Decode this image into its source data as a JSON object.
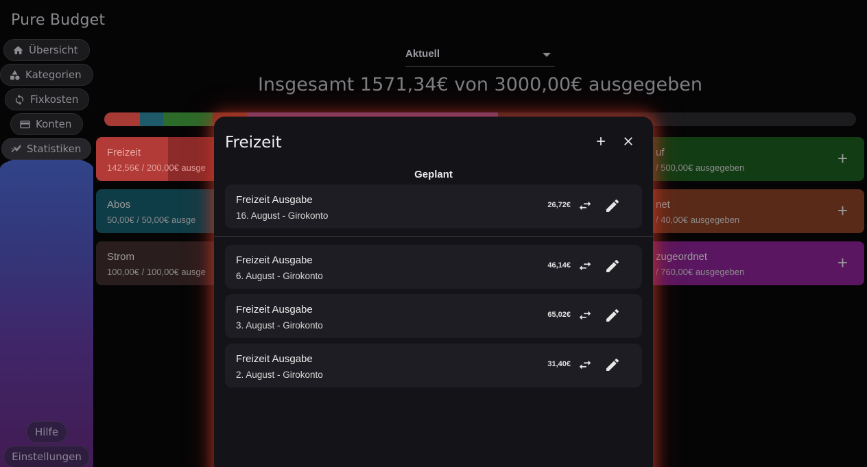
{
  "app": {
    "title": "Pure Budget"
  },
  "sidebar": {
    "items": [
      {
        "label": "Übersicht",
        "icon": "home-icon"
      },
      {
        "label": "Kategorien",
        "icon": "shapes-icon"
      },
      {
        "label": "Fixkosten",
        "icon": "sync-icon"
      },
      {
        "label": "Konten",
        "icon": "wallet-icon"
      },
      {
        "label": "Statistiken",
        "icon": "chart-icon",
        "active": true
      }
    ],
    "bottom": {
      "help": "Hilfe",
      "settings": "Einstellungen"
    }
  },
  "main": {
    "period": {
      "selected": "Aktuell"
    },
    "total_text": "Insgesamt 1571,34€ von 3000,00€ ausgegeben",
    "progress": {
      "spent": 1571.34,
      "budget": 3000.0
    },
    "categories": [
      {
        "name": "Freizeit",
        "value": "142,56€ / 200,00€ ausge",
        "color": "#b23a37"
      },
      {
        "name": "Abos",
        "value": "50,00€ / 50,00€ ausge",
        "color": "#0f3d47"
      },
      {
        "name": "Strom",
        "value": "100,00€ / 100,00€ ausge",
        "color": "#2a1d1d"
      },
      {
        "name": "uf",
        "value": "/ 500,00€ ausgegeben",
        "color": "#123d14"
      },
      {
        "name": "net",
        "value": "/ 40,00€ ausgegeben",
        "color": "#5a2a18"
      },
      {
        "name": "zugeordnet",
        "value": "/ 760,00€ ausgegeben",
        "color": "#5a1660"
      }
    ],
    "plus_label": "+"
  },
  "modal": {
    "title": "Freizeit",
    "section_label": "Geplant",
    "planned": [
      {
        "title": "Freizeit Ausgabe",
        "subtitle": "16. August - Girokonto",
        "amount": "26,72€"
      }
    ],
    "expenses": [
      {
        "title": "Freizeit Ausgabe",
        "subtitle": "6. August - Girokonto",
        "amount": "46,14€"
      },
      {
        "title": "Freizeit Ausgabe",
        "subtitle": "3. August - Girokonto",
        "amount": "65,02€"
      },
      {
        "title": "Freizeit Ausgabe",
        "subtitle": "2. August - Girokonto",
        "amount": "31,40€"
      }
    ]
  },
  "colors": {
    "modal_glow": "#c83c28",
    "modal_bg": "#141318",
    "card_bg": "#1e1d23"
  }
}
